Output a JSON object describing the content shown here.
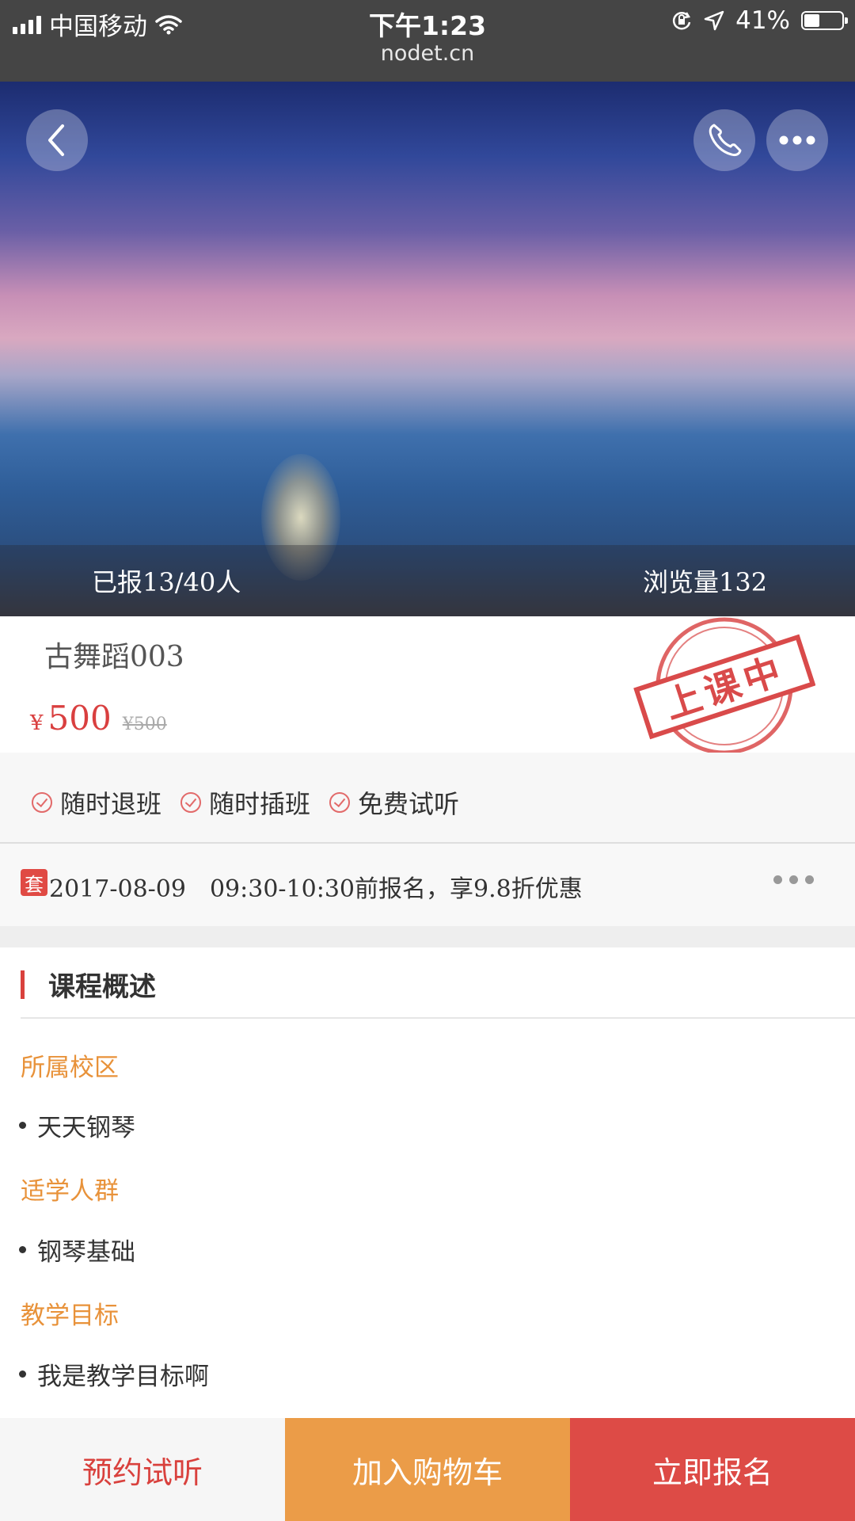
{
  "status_bar": {
    "carrier": "中国移动",
    "time": "下午1:23",
    "url": "nodet.cn",
    "battery_percent": "41%",
    "battery_level": 0.41
  },
  "hero": {
    "enrolled": "已报13/40人",
    "views": "浏览量132"
  },
  "course": {
    "title": "古舞蹈003",
    "currency": "¥",
    "price": "500",
    "original_price": "¥500",
    "stamp_text": "上课中"
  },
  "features": [
    "随时退班",
    "随时插班",
    "免费试听"
  ],
  "promo": {
    "tag": "套",
    "text": "2017-08-09　09:30-10:30前报名，享9.8折优惠"
  },
  "overview": {
    "heading": "课程概述",
    "sections": [
      {
        "label": "所属校区",
        "item": "天天钢琴"
      },
      {
        "label": "适学人群",
        "item": "钢琴基础"
      },
      {
        "label": "教学目标",
        "item": "我是教学目标啊"
      }
    ]
  },
  "footer": {
    "trial": "预约试听",
    "cart": "加入购物车",
    "signup": "立即报名"
  },
  "colors": {
    "accent_red": "#d9413d",
    "accent_orange": "#eb9c48",
    "subhead_orange": "#e8923a"
  },
  "icons": [
    "signal-icon",
    "wifi-icon",
    "orientation-lock-icon",
    "location-icon",
    "battery-icon",
    "back-icon",
    "phone-icon",
    "more-icon",
    "check-icon"
  ]
}
